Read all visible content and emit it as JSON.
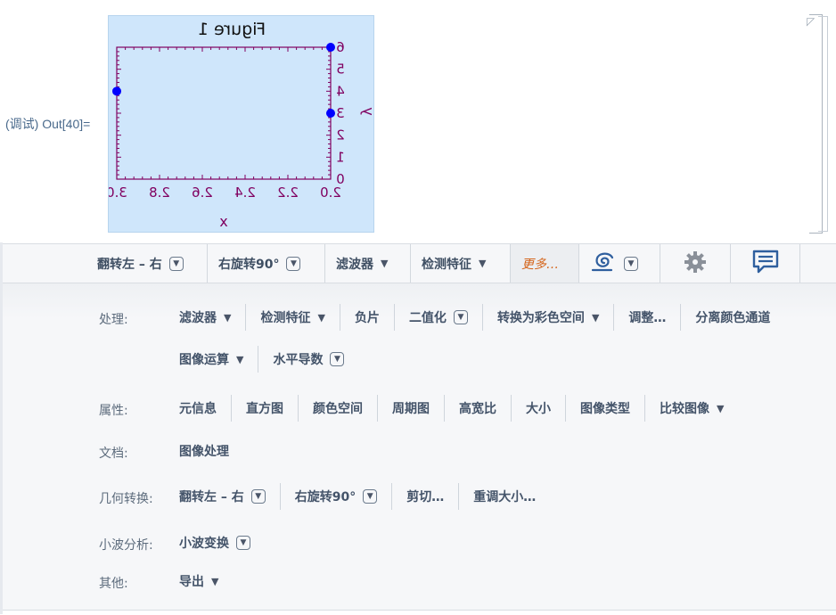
{
  "cell": {
    "output_label": "(调试) Out[40]="
  },
  "figure": {
    "title": "Figure 1",
    "xlabel": "x",
    "ylabel": "y",
    "x_ticks": [
      "3.0",
      "2.8",
      "2.6",
      "2.4",
      "2.2",
      "2.0"
    ],
    "y_ticks": [
      "6",
      "5",
      "4",
      "3",
      "2",
      "1",
      "0"
    ]
  },
  "chart_data": {
    "type": "scatter",
    "title": "Figure 1",
    "xlabel": "x",
    "ylabel": "y",
    "mirrored": true,
    "xlim": [
      2.0,
      3.0
    ],
    "ylim": [
      0,
      6
    ],
    "points": [
      {
        "x": 3.0,
        "y": 4.0
      },
      {
        "x": 2.0,
        "y": 6.0
      },
      {
        "x": 2.0,
        "y": 3.0
      }
    ],
    "marker_color": "#0000ff",
    "axis_color": "#800060",
    "background": "#cfe6fb"
  },
  "toolbar": {
    "items": [
      {
        "label": "翻转左 – 右",
        "control": "box"
      },
      {
        "label": "右旋转90°",
        "control": "box"
      },
      {
        "label": "滤波器",
        "control": "tri"
      },
      {
        "label": "检测特征",
        "control": "tri"
      },
      {
        "label": "更多…",
        "control": "none"
      }
    ],
    "icons": [
      "swirl-icon",
      "gear-icon",
      "chat-icon"
    ]
  },
  "panel": {
    "processing": {
      "label": "处理:",
      "row1": [
        {
          "label": "滤波器",
          "control": "tri"
        },
        {
          "label": "检测特征",
          "control": "tri"
        },
        {
          "label": "负片",
          "control": "none"
        },
        {
          "label": "二值化",
          "control": "box"
        },
        {
          "label": "转换为彩色空间",
          "control": "tri"
        },
        {
          "label": "调整…",
          "control": "none"
        },
        {
          "label": "分离颜色通道",
          "control": "none"
        }
      ],
      "row2": [
        {
          "label": "图像运算",
          "control": "tri"
        },
        {
          "label": "水平导数",
          "control": "box"
        }
      ]
    },
    "properties": {
      "label": "属性:",
      "items": [
        {
          "label": "元信息",
          "control": "none"
        },
        {
          "label": "直方图",
          "control": "none"
        },
        {
          "label": "颜色空间",
          "control": "none"
        },
        {
          "label": "周期图",
          "control": "none"
        },
        {
          "label": "高宽比",
          "control": "none"
        },
        {
          "label": "大小",
          "control": "none"
        },
        {
          "label": "图像类型",
          "control": "none"
        },
        {
          "label": "比较图像",
          "control": "tri"
        }
      ]
    },
    "docs": {
      "label": "文档:",
      "items": [
        {
          "label": "图像处理",
          "control": "none"
        }
      ]
    },
    "geometry": {
      "label": "几何转换:",
      "items": [
        {
          "label": "翻转左 – 右",
          "control": "box"
        },
        {
          "label": "右旋转90°",
          "control": "box"
        },
        {
          "label": "剪切…",
          "control": "none"
        },
        {
          "label": "重调大小…",
          "control": "none"
        }
      ]
    },
    "wavelet": {
      "label": "小波分析:",
      "items": [
        {
          "label": "小波变换",
          "control": "box"
        }
      ]
    },
    "other": {
      "label": "其他:",
      "items": [
        {
          "label": "导出",
          "control": "tri"
        }
      ]
    }
  },
  "colors": {
    "accent": "#d4641a",
    "text": "#44546a",
    "panel_bg": "#f6f7f9"
  }
}
